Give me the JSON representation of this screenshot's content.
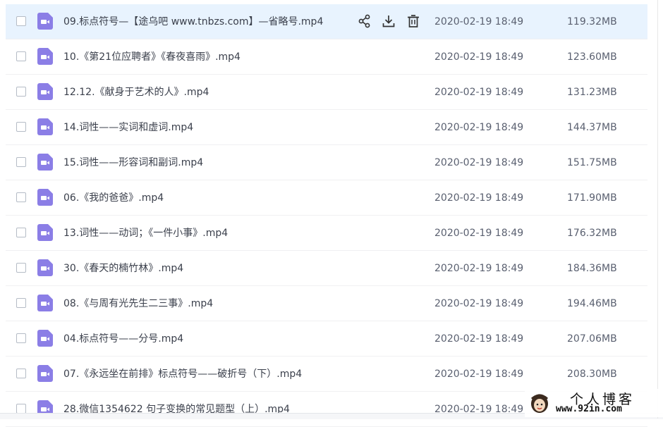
{
  "colors": {
    "accent_file_icon": "#8b7ee6",
    "hover_row": "#e8f3fe",
    "text_primary": "#3a3f4b",
    "text_secondary": "#5a6070"
  },
  "row_actions": {
    "share_icon": "share-icon",
    "download_icon": "download-icon",
    "delete_icon": "delete-icon"
  },
  "files": [
    {
      "name": "09.标点符号—【途乌吧 www.tnbzs.com】—省略号.mp4",
      "date": "2020-02-19 18:49",
      "size": "119.32MB"
    },
    {
      "name": "10.《第21位应聘者》《春夜喜雨》.mp4",
      "date": "2020-02-19 18:49",
      "size": "123.60MB"
    },
    {
      "name": "12.12.《献身于艺术的人》.mp4",
      "date": "2020-02-19 18:49",
      "size": "131.23MB"
    },
    {
      "name": "14.词性——实词和虚词.mp4",
      "date": "2020-02-19 18:49",
      "size": "144.37MB"
    },
    {
      "name": "15.词性——形容词和副词.mp4",
      "date": "2020-02-19 18:49",
      "size": "151.75MB"
    },
    {
      "name": "06.《我的爸爸》.mp4",
      "date": "2020-02-19 18:49",
      "size": "171.90MB"
    },
    {
      "name": "13.词性——动词；《一件小事》.mp4",
      "date": "2020-02-19 18:49",
      "size": "176.32MB"
    },
    {
      "name": "30.《春天的楠竹林》.mp4",
      "date": "2020-02-19 18:49",
      "size": "184.36MB"
    },
    {
      "name": "08.《与周有光先生二三事》.mp4",
      "date": "2020-02-19 18:49",
      "size": "194.46MB"
    },
    {
      "name": "04.标点符号——分号.mp4",
      "date": "2020-02-19 18:49",
      "size": "207.06MB"
    },
    {
      "name": "07.《永远坐在前排》标点符号——破折号（下）.mp4",
      "date": "2020-02-19 18:49",
      "size": "208.30MB"
    },
    {
      "name": "28.微信1354622 句子变换的常见题型（上）.mp4",
      "date": "2020-02-19 18:49",
      "size": ""
    }
  ],
  "watermark": {
    "title": "个人博客",
    "url": "www.92in.com"
  }
}
